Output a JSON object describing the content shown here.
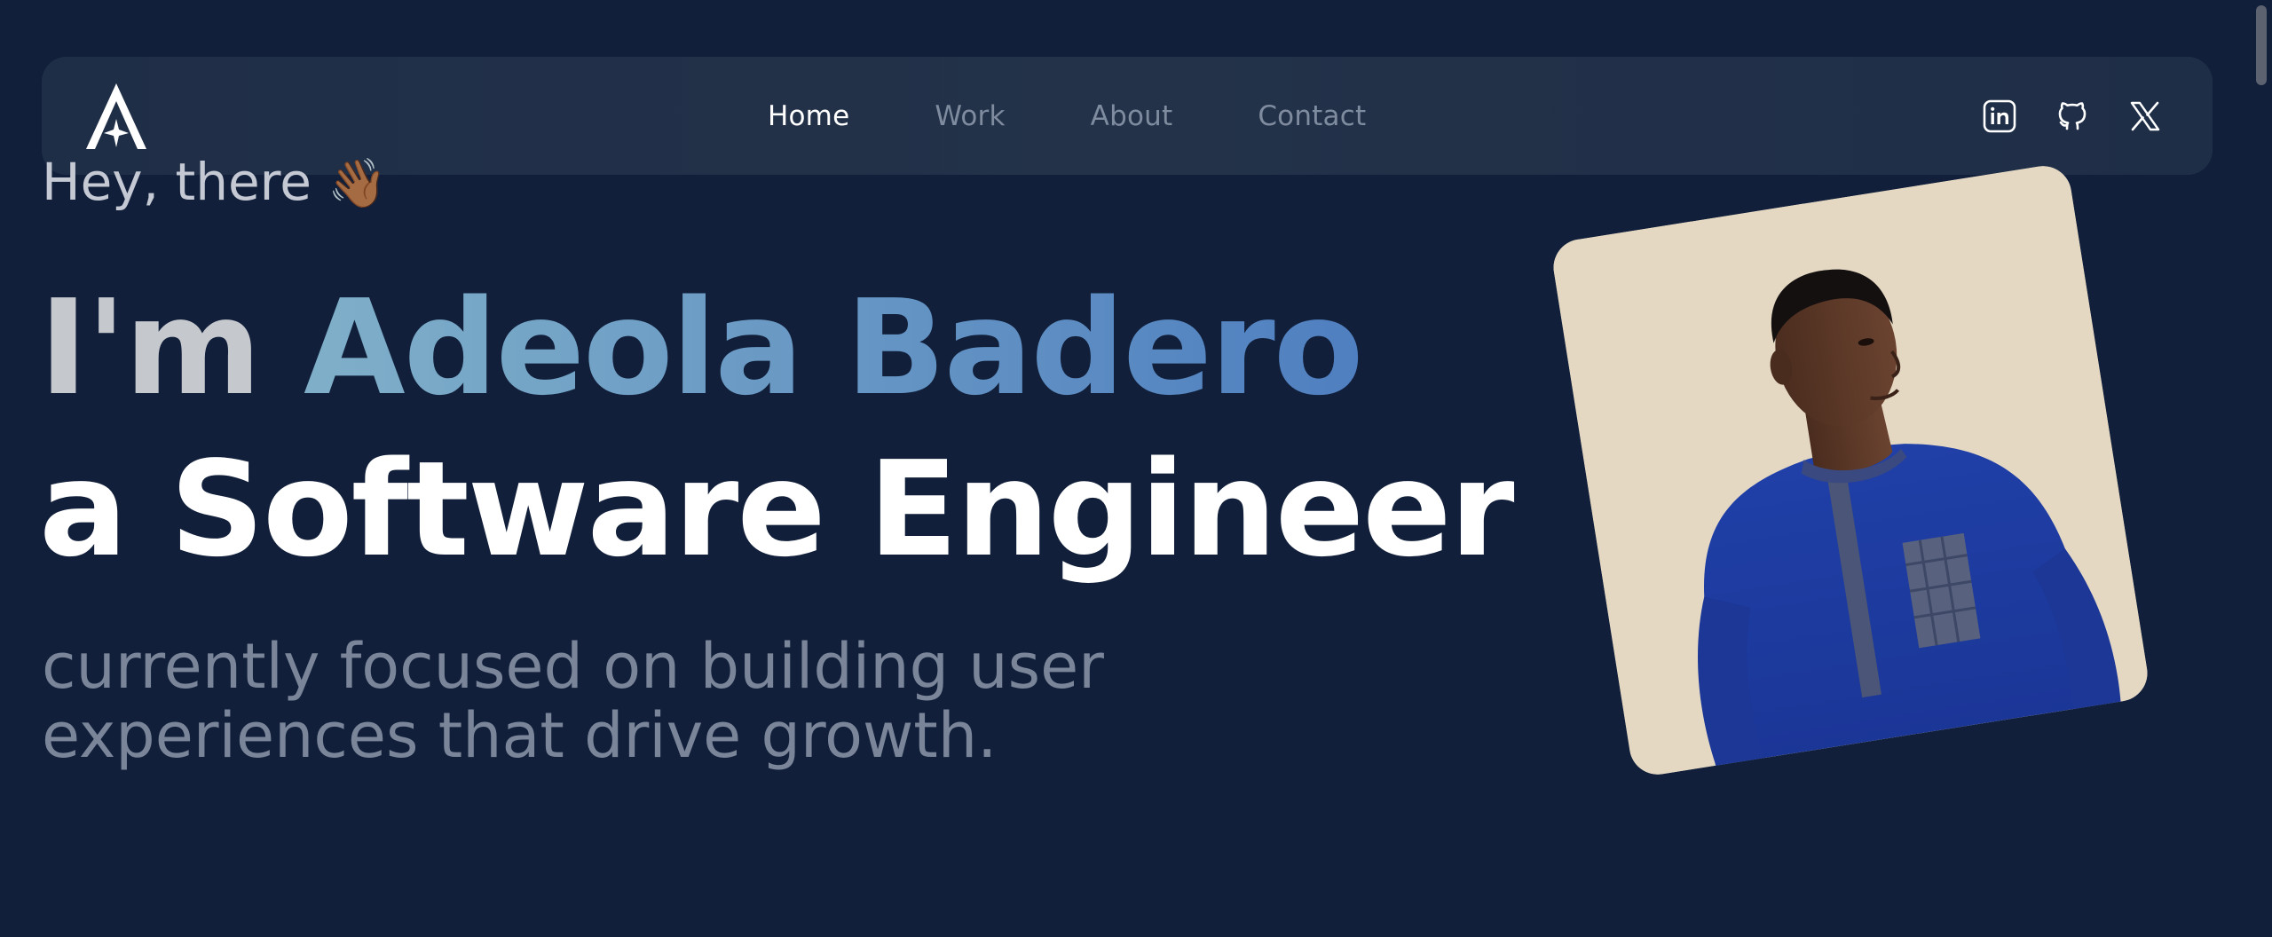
{
  "nav": {
    "logo_name": "brand-logo",
    "links": [
      {
        "label": "Home",
        "active": true
      },
      {
        "label": "Work",
        "active": false
      },
      {
        "label": "About",
        "active": false
      },
      {
        "label": "Contact",
        "active": false
      }
    ],
    "social": [
      {
        "icon": "linkedin-icon"
      },
      {
        "icon": "github-icon"
      },
      {
        "icon": "x-twitter-icon"
      }
    ]
  },
  "hero": {
    "greeting": "Hey, there",
    "wave_emoji": "👋🏾",
    "headline_prefix": "I'm",
    "name": "Adeola Badero",
    "role": "a Software Engineer",
    "subtitle_line1": "currently focused on building user",
    "subtitle_line2": "experiences that drive growth."
  },
  "colors": {
    "background": "#111f3a",
    "navbar": "#233249",
    "name_gradient_start": "#7fafc8",
    "name_gradient_end": "#4f7fc0",
    "portrait_bg": "#e4d8c3"
  }
}
